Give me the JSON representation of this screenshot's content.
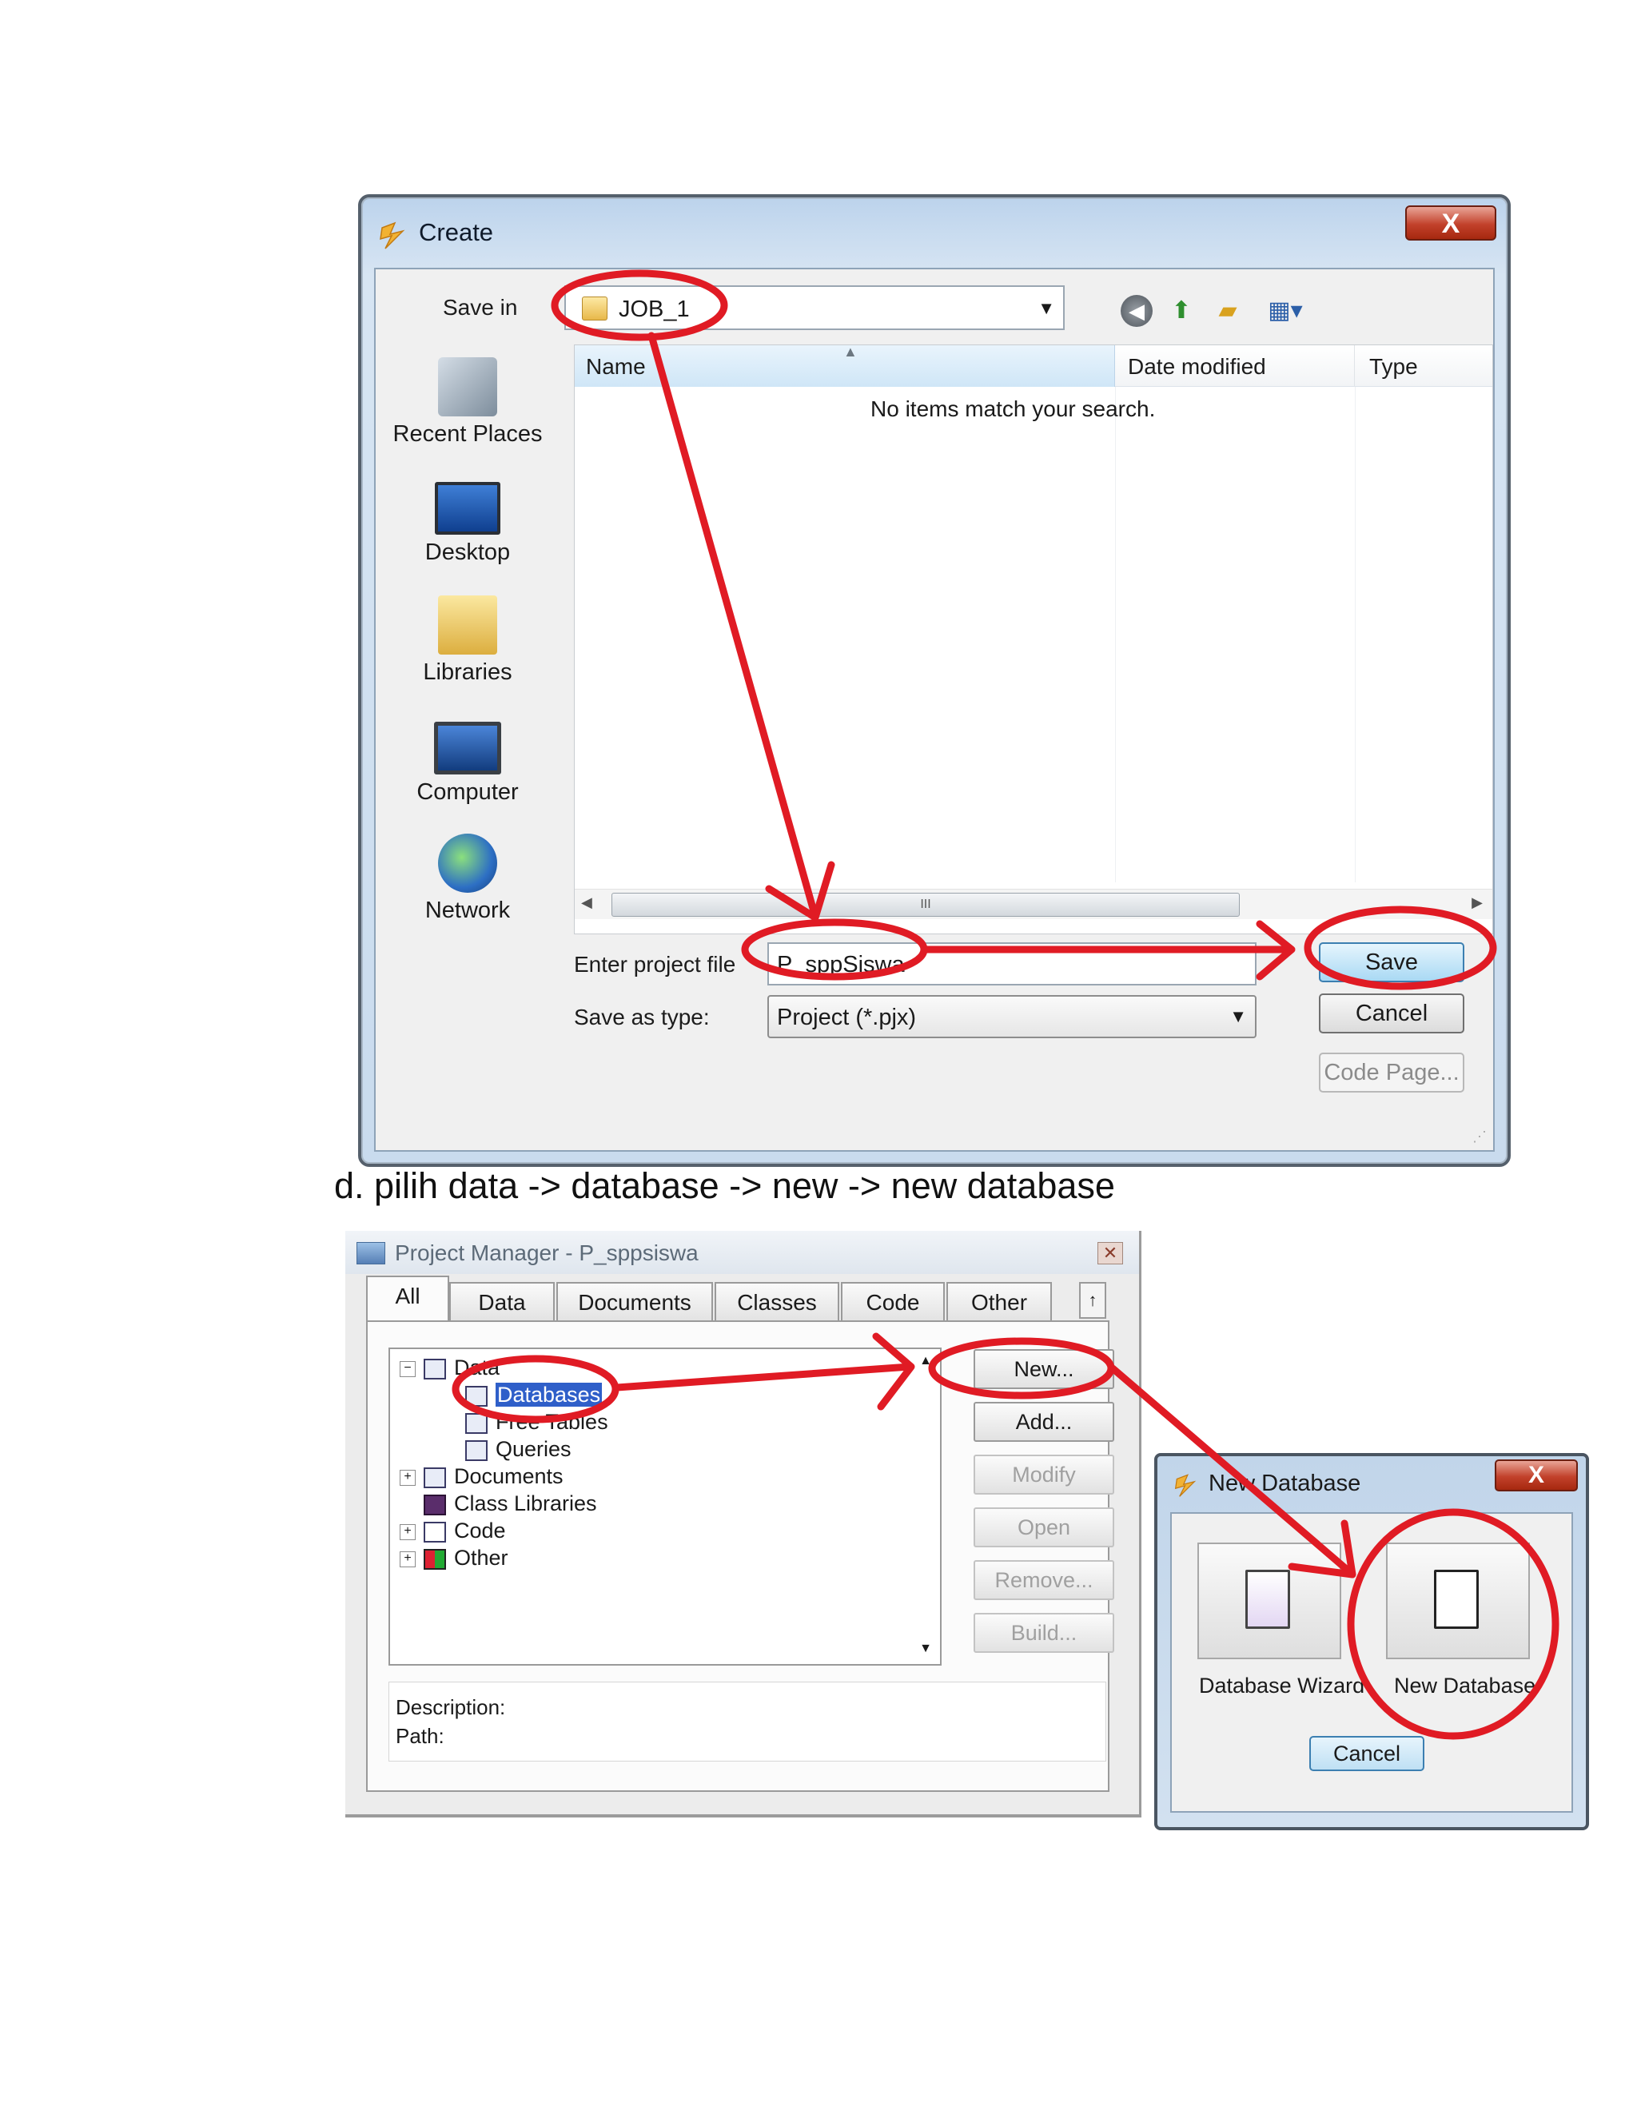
{
  "create_dialog": {
    "title": "Create",
    "close_label": "X",
    "save_in_label": "Save in",
    "save_in_value": "JOB_1",
    "places": [
      {
        "label": "Recent Places",
        "icon": "recent-places-icon"
      },
      {
        "label": "Desktop",
        "icon": "desktop-icon"
      },
      {
        "label": "Libraries",
        "icon": "libraries-icon"
      },
      {
        "label": "Computer",
        "icon": "computer-icon"
      },
      {
        "label": "Network",
        "icon": "network-icon"
      }
    ],
    "columns": {
      "name": "Name",
      "date_modified": "Date modified",
      "type": "Type"
    },
    "empty_message": "No items match your search.",
    "scroll_thumb_glyph": "III",
    "enter_file_label": "Enter project file",
    "project_file_value": "P_sppSiswa",
    "save_as_type_label": "Save as type:",
    "save_as_type_value": "Project (*.pjx)",
    "buttons": {
      "save": "Save",
      "cancel": "Cancel",
      "code_page": "Code Page..."
    }
  },
  "caption": "d.  pilih data -> database -> new -> new database",
  "project_manager": {
    "title": "Project Manager - P_sppsiswa",
    "tabs": [
      "All",
      "Data",
      "Documents",
      "Classes",
      "Code",
      "Other"
    ],
    "tree": [
      {
        "label": "Data",
        "level": 0,
        "expander": "−"
      },
      {
        "label": "Databases",
        "level": 1,
        "selected": true
      },
      {
        "label": "Free Tables",
        "level": 1
      },
      {
        "label": "Queries",
        "level": 1
      },
      {
        "label": "Documents",
        "level": 0,
        "expander": "+"
      },
      {
        "label": "Class Libraries",
        "level": 0
      },
      {
        "label": "Code",
        "level": 0,
        "expander": "+"
      },
      {
        "label": "Other",
        "level": 0,
        "expander": "+"
      }
    ],
    "buttons": [
      {
        "label": "New...",
        "enabled": true
      },
      {
        "label": "Add...",
        "enabled": true
      },
      {
        "label": "Modify",
        "enabled": false
      },
      {
        "label": "Open",
        "enabled": false
      },
      {
        "label": "Remove...",
        "enabled": false
      },
      {
        "label": "Build...",
        "enabled": false
      }
    ],
    "description_label": "Description:",
    "path_label": "Path:"
  },
  "new_database_dialog": {
    "title": "New Database",
    "close_label": "X",
    "wizard_label": "Database Wizard",
    "new_label": "New Database",
    "cancel_label": "Cancel"
  },
  "colors": {
    "annotation_red": "#e01b24",
    "selection_blue": "#2f5fc9"
  }
}
